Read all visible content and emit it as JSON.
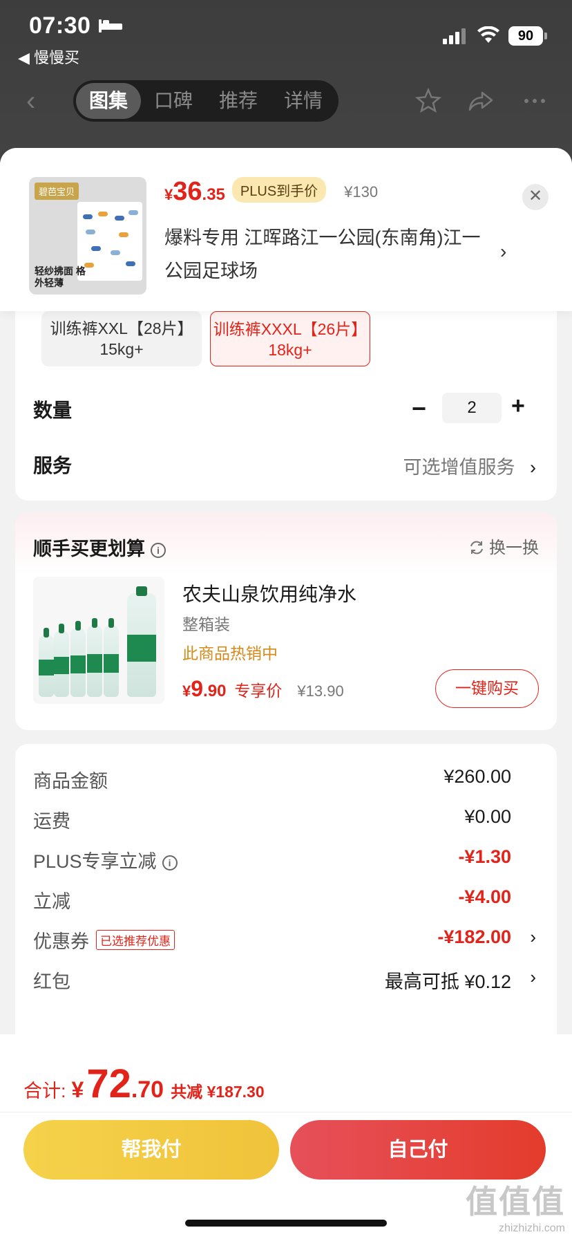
{
  "status": {
    "time": "07:30",
    "back_app": "◀ 慢慢买",
    "battery": "90"
  },
  "nav": {
    "tabs": [
      {
        "label": "图集",
        "active": true
      },
      {
        "label": "口碑",
        "active": false
      },
      {
        "label": "推荐",
        "active": false
      },
      {
        "label": "详情",
        "active": false
      }
    ]
  },
  "product": {
    "image_brand": "碧芭宝贝",
    "image_caption": "轻纱拂面 格外轻薄",
    "price_symbol": "¥",
    "price_int": "36",
    "price_dec": ".35",
    "plus_badge": "PLUS到手价",
    "original_price": "¥130",
    "address": "爆料专用  江晖路江一公园(东南角)江一公园足球场"
  },
  "specs": {
    "options": [
      {
        "label": "训练裤XXL【28片】15kg+",
        "selected": false
      },
      {
        "label": "训练裤XXXL【26片】18kg+",
        "selected": true
      }
    ]
  },
  "quantity": {
    "label": "数量",
    "value": "2",
    "minus": "−",
    "plus": "+"
  },
  "service": {
    "label": "服务",
    "value": "可选增值服务",
    "arrow": "›"
  },
  "recommend": {
    "title": "顺手买更划算",
    "swap_label": "换一换",
    "item": {
      "name": "农夫山泉饮用纯净水",
      "sub": "整箱装",
      "hot": "此商品热销中",
      "price_symbol": "¥",
      "price_int": "9",
      "price_dec": ".90",
      "tag": "专享价",
      "original_price": "¥13.90",
      "buy_label": "一键购买"
    }
  },
  "summary": {
    "rows": [
      {
        "label": "商品金额",
        "value": "¥260.00"
      },
      {
        "label": "运费",
        "value": "¥0.00"
      },
      {
        "label": "PLUS专享立减",
        "value": "-¥1.30"
      },
      {
        "label": "立减",
        "value": "-¥4.00"
      },
      {
        "label": "优惠券",
        "badge": "已选推荐优惠",
        "value": "-¥182.00"
      },
      {
        "label": "红包",
        "value": "最高可抵 ¥0.12"
      }
    ]
  },
  "footer": {
    "total_label": "合计:",
    "total_symbol": "¥",
    "total_int": "72",
    "total_dec": ".70",
    "saved": "共减 ¥187.30",
    "help_pay": "帮我付",
    "self_pay": "自己付"
  },
  "watermark": {
    "big": "值值值",
    "small": "zhizhizhi.com"
  },
  "colors": {
    "accent_red": "#e2231a",
    "plus_gold": "#fbe7b0",
    "help_yellow": "#f5d24b"
  }
}
